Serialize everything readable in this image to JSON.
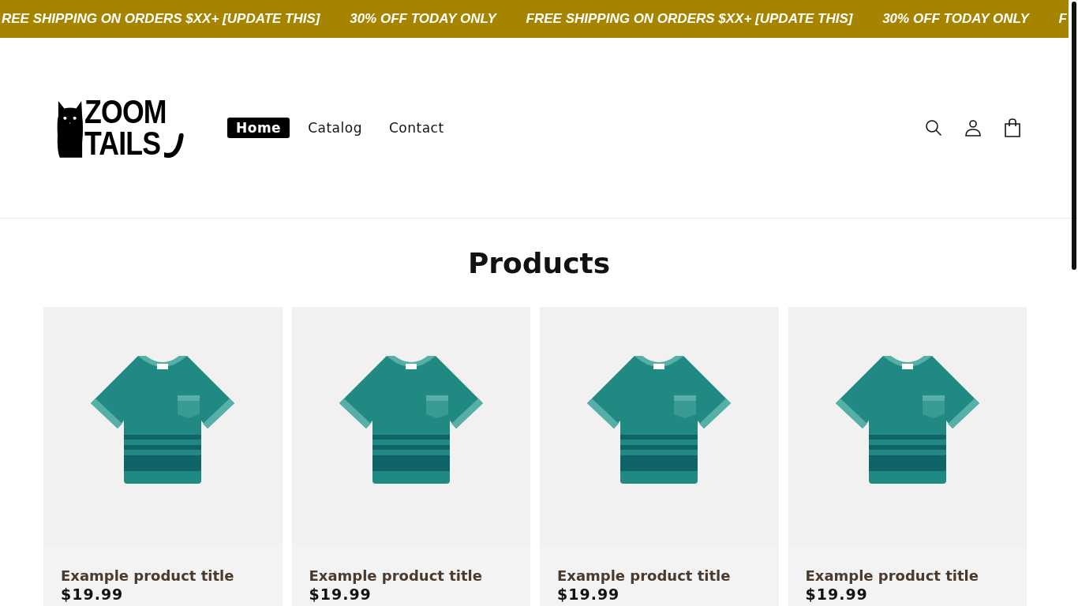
{
  "announcement_bar": [
    "REE SHIPPING ON ORDERS $XX+ [UPDATE THIS]",
    "30% OFF TODAY ONLY",
    "FREE SHIPPING ON ORDERS $XX+ [UPDATE THIS]",
    "30% OFF TODAY ONLY",
    "F"
  ],
  "header": {
    "logo": [
      "ZOOM",
      "TAILS"
    ],
    "nav": [
      {
        "label": "Home",
        "selected": true
      },
      {
        "label": "Catalog",
        "selected": false
      },
      {
        "label": "Contact",
        "selected": false
      }
    ]
  },
  "section_title": "Products",
  "products": [
    {
      "title": "Example product title",
      "price": "$19.99"
    },
    {
      "title": "Example product title",
      "price": "$19.99"
    },
    {
      "title": "Example product title",
      "price": "$19.99"
    },
    {
      "title": "Example product title",
      "price": "$19.99"
    }
  ]
}
